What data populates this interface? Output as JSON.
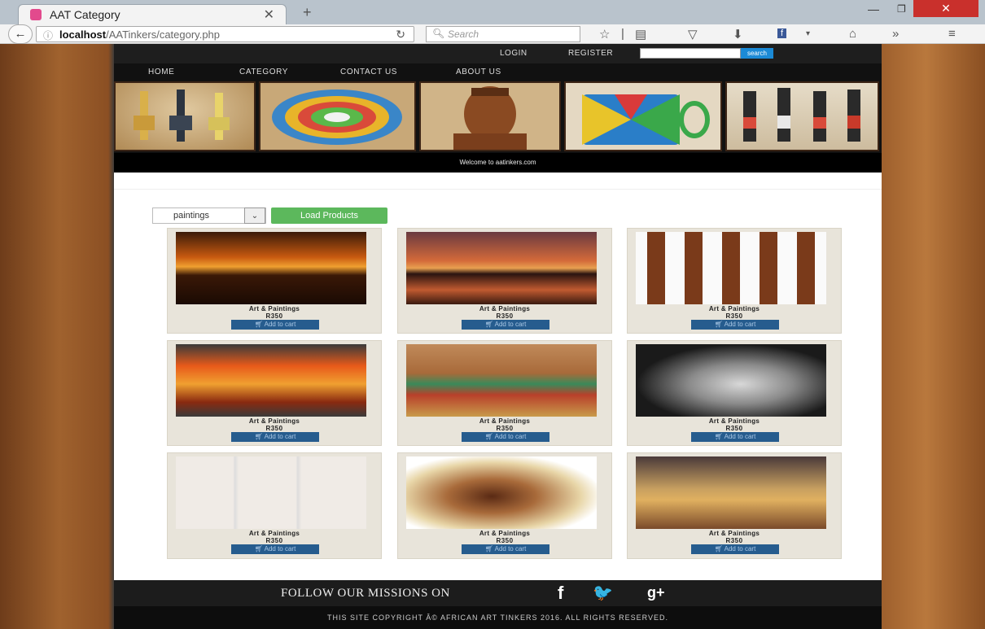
{
  "browser": {
    "tab_title": "AAT Category",
    "tab_close": "✕",
    "new_tab": "+",
    "url_host": "localhost",
    "url_path": "/AATinkers/category.php",
    "search_placeholder": "Search",
    "win_min": "—",
    "win_max": "❐",
    "win_close": "✕"
  },
  "site": {
    "top": {
      "login": "LOGIN",
      "register": "REGISTER",
      "search_button": "search"
    },
    "menu": [
      "HOME",
      "CATEGORY",
      "CONTACT US",
      "ABOUT US"
    ],
    "banner_images": [
      "giraffe-carvings",
      "woven-spiral-bowl",
      "carved-face-bust",
      "beaded-mug",
      "beaded-figurines"
    ],
    "welcome": "Welcome to aatinkers.com",
    "category": {
      "selected": "paintings",
      "load_button": "Load Products"
    },
    "products": [
      {
        "name": "Art & Paintings",
        "price": "R350",
        "cart": "Add to cart",
        "image": "elephants-sunset"
      },
      {
        "name": "Art & Paintings",
        "price": "R350",
        "cart": "Add to cart",
        "image": "elephant-lake-sunset"
      },
      {
        "name": "Art & Paintings",
        "price": "R350",
        "cart": "Add to cart",
        "image": "tribal-masks"
      },
      {
        "name": "Art & Paintings",
        "price": "R350",
        "cart": "Add to cart",
        "image": "savanna-canvas"
      },
      {
        "name": "Art & Paintings",
        "price": "R350",
        "cart": "Add to cart",
        "image": "women-carrying-wood"
      },
      {
        "name": "Art & Paintings",
        "price": "R350",
        "cart": "Add to cart",
        "image": "woman-portrait"
      },
      {
        "name": "Art & Paintings",
        "price": "R350",
        "cart": "Add to cart",
        "image": "red-dress-women"
      },
      {
        "name": "Art & Paintings",
        "price": "R350",
        "cart": "Add to cart",
        "image": "zulu-warrior"
      },
      {
        "name": "Art & Paintings",
        "price": "R350",
        "cart": "Add to cart",
        "image": "dancers"
      }
    ],
    "footer": {
      "follow": "FOLLOW OUR MISSIONS ON",
      "social": [
        "f",
        "🐦",
        "g+"
      ],
      "copyright": "THIS SITE COPYRIGHT Â© AFRICAN ART TINKERS 2016. ALL RIGHTS RESERVED."
    }
  },
  "colors": {
    "load_button": "#5cb85c",
    "cart_button": "#265c8e",
    "search_button": "#1b8ad6"
  }
}
